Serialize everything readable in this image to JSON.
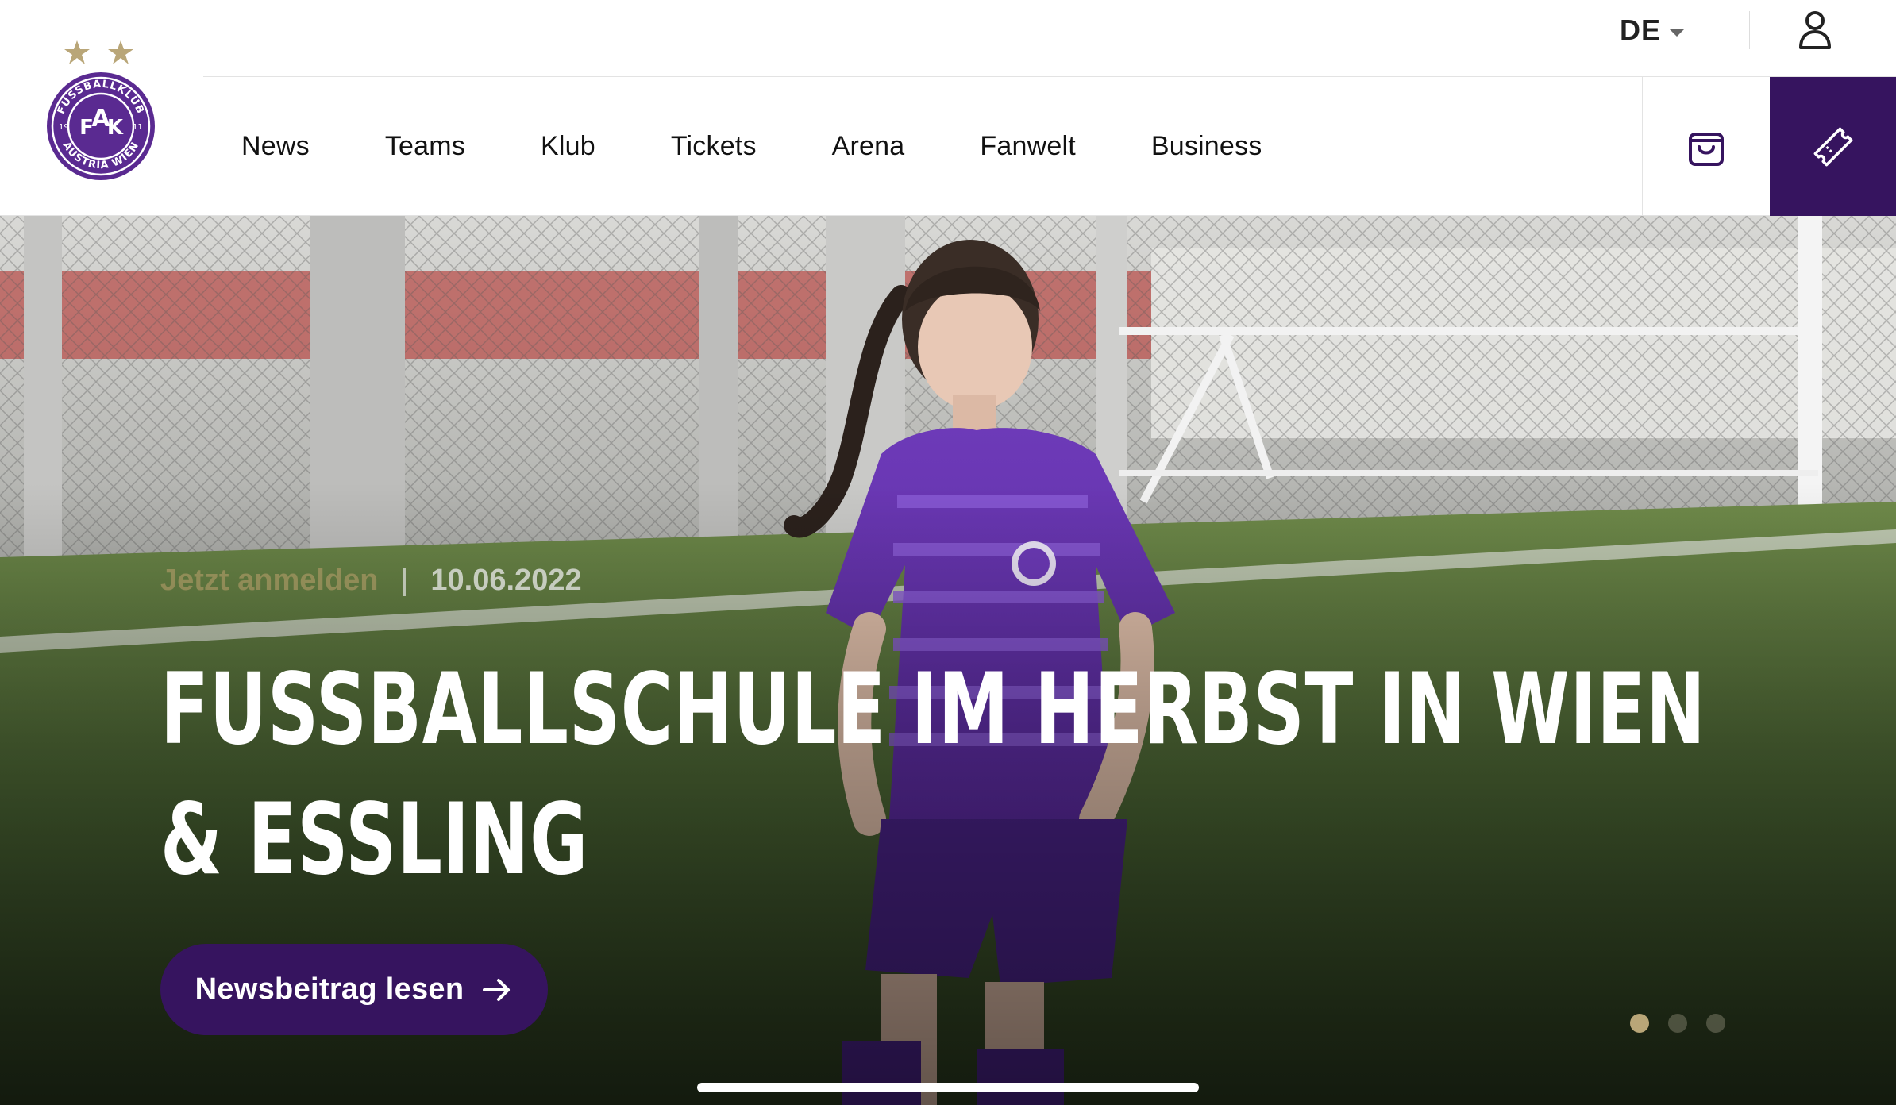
{
  "header": {
    "logo": {
      "top_text": "FUSSBALLKLUB",
      "bottom_text": "AUSTRIA WIEN",
      "year_left": "19",
      "year_right": "11",
      "monogram_left": "F",
      "monogram_center": "A",
      "monogram_right": "K"
    },
    "language": "DE",
    "user_icon": "user-icon",
    "cart_icon": "shopping-bag-icon",
    "ticket_icon": "ticket-icon"
  },
  "nav": {
    "items": [
      {
        "label": "News"
      },
      {
        "label": "Teams"
      },
      {
        "label": "Klub"
      },
      {
        "label": "Tickets"
      },
      {
        "label": "Arena"
      },
      {
        "label": "Fanwelt"
      },
      {
        "label": "Business"
      }
    ]
  },
  "hero": {
    "category": "Jetzt anmelden",
    "separator": "|",
    "date": "10.06.2022",
    "headline": "FUSSBALLSCHULE IM HERBST IN WIEN & ESSLING",
    "cta_label": "Newsbeitrag lesen",
    "cta_icon": "arrow-right-icon",
    "slides": 3,
    "active_slide": 1
  },
  "colors": {
    "brand_purple": "#36145f",
    "gold": "#b9a678",
    "text": "#111111"
  }
}
